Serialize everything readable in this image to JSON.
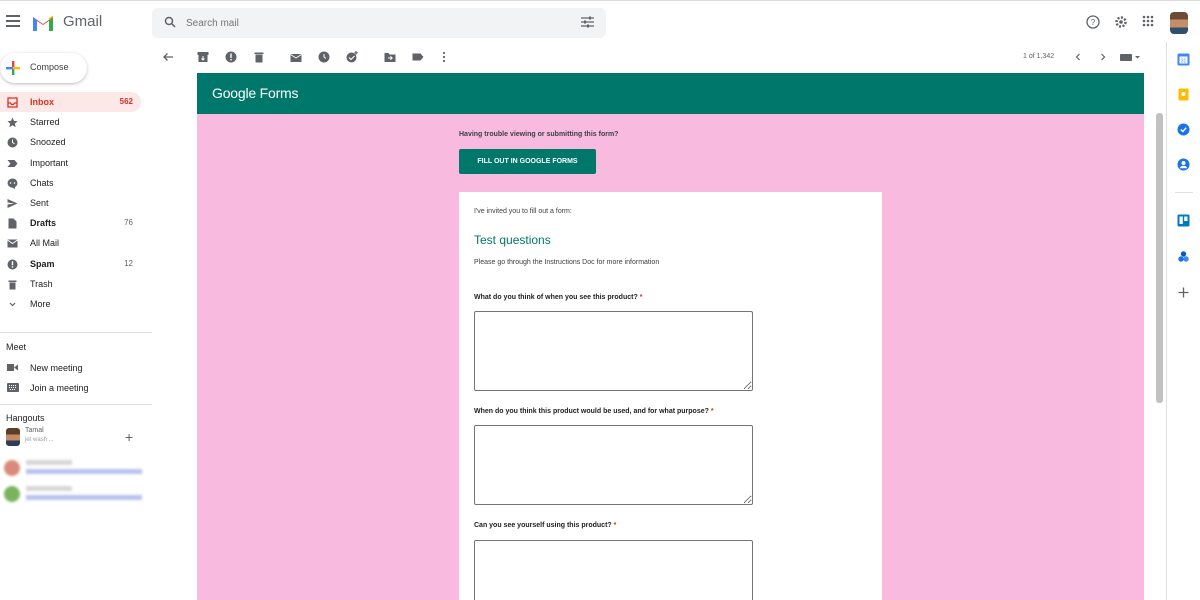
{
  "app": {
    "brand": "Gmail"
  },
  "search": {
    "placeholder": "Search mail"
  },
  "compose": {
    "label": "Compose"
  },
  "nav": [
    {
      "label": "Inbox",
      "count": "562",
      "icon": "inbox-icon"
    },
    {
      "label": "Starred",
      "count": "",
      "icon": "star-icon"
    },
    {
      "label": "Snoozed",
      "count": "",
      "icon": "clock-icon"
    },
    {
      "label": "Important",
      "count": "",
      "icon": "important-icon"
    },
    {
      "label": "Chats",
      "count": "",
      "icon": "chat-icon"
    },
    {
      "label": "Sent",
      "count": "",
      "icon": "send-icon"
    },
    {
      "label": "Drafts",
      "count": "76",
      "icon": "draft-icon"
    },
    {
      "label": "All Mail",
      "count": "",
      "icon": "mail-icon"
    },
    {
      "label": "Spam",
      "count": "12",
      "icon": "spam-icon"
    },
    {
      "label": "Trash",
      "count": "",
      "icon": "trash-icon"
    },
    {
      "label": "More",
      "count": "",
      "icon": "chevron-down-icon"
    }
  ],
  "meet": {
    "title": "Meet",
    "new_meeting": "New meeting",
    "join_meeting": "Join a meeting"
  },
  "hangouts": {
    "title": "Hangouts",
    "user_name": "Tamal",
    "user_status": "jet wash ..."
  },
  "pager": {
    "text": "1 of 1,342"
  },
  "form": {
    "header": "Google Forms",
    "trouble": "Having trouble viewing or submitting this form?",
    "fill_button": "FILL OUT IN GOOGLE FORMS",
    "invite": "I've invited you to fill out a form:",
    "title": "Test questions",
    "description": "Please go through the Instructions Doc for more information",
    "questions": [
      {
        "text": "What do you think of when you see this product?",
        "required_mark": "*"
      },
      {
        "text": "When do you think this product would be used, and for what purpose?",
        "required_mark": "*"
      },
      {
        "text": "Can you see yourself using this product?",
        "required_mark": "*"
      }
    ]
  },
  "colors": {
    "accent_red": "#d93025",
    "forms_green": "#00776b",
    "form_background": "#f8bbdf"
  }
}
